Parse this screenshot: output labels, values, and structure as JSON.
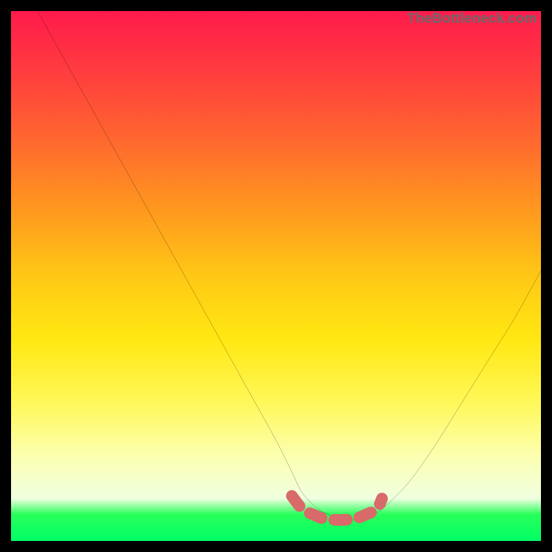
{
  "watermark": "TheBottleneck.com",
  "chart_data": {
    "type": "line",
    "title": "",
    "xlabel": "",
    "ylabel": "",
    "xlim": [
      0,
      100
    ],
    "ylim": [
      0,
      100
    ],
    "series": [
      {
        "name": "bottleneck-curve",
        "x": [
          5,
          10,
          15,
          20,
          25,
          30,
          35,
          40,
          45,
          50,
          53,
          55,
          58,
          60,
          62,
          64,
          66,
          68,
          70,
          75,
          80,
          85,
          90,
          95,
          100
        ],
        "values": [
          100,
          91,
          82,
          73,
          64,
          55,
          46,
          37,
          28,
          19,
          13,
          9,
          6,
          5,
          4,
          4,
          4,
          5,
          6,
          11,
          18,
          26,
          34,
          42,
          51
        ]
      }
    ],
    "highlight": {
      "name": "ideal-range-marker",
      "x": [
        53,
        55,
        57,
        59,
        61,
        63,
        65,
        67,
        69,
        70
      ],
      "values": [
        8.5,
        6,
        5,
        4.2,
        4,
        4,
        4.2,
        5,
        6,
        8
      ],
      "color": "#d86a6a"
    }
  },
  "colors": {
    "curve": "#000000",
    "highlight": "#d86a6a",
    "frame": "#000000",
    "watermark": "#6a6a6a"
  }
}
